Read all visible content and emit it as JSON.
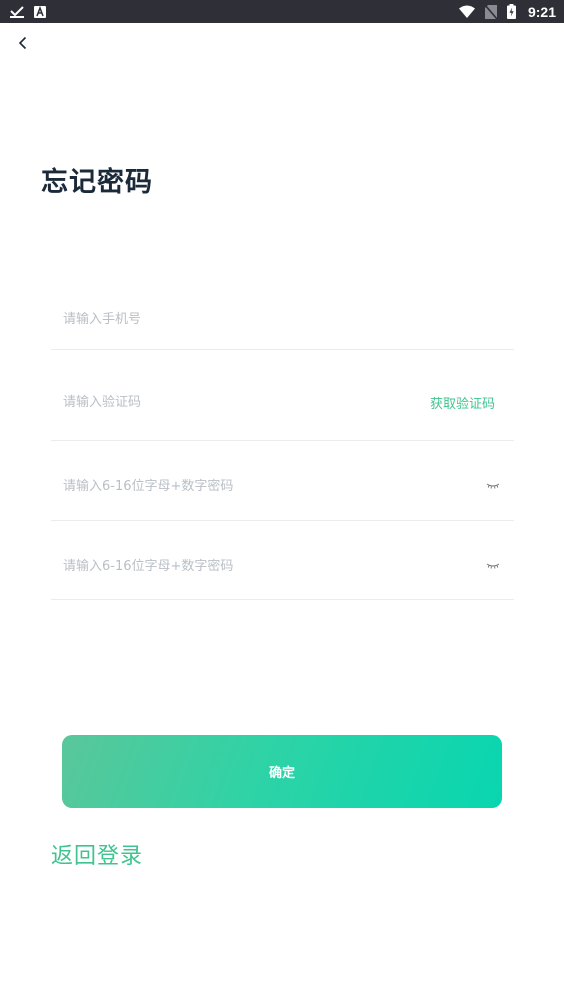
{
  "status_bar": {
    "time": "9:21",
    "left_icons": [
      "check-download-icon",
      "text-notification-icon"
    ],
    "right_icons": [
      "wifi-icon",
      "no-sim-icon",
      "battery-charging-icon"
    ],
    "bar_color": "#2f2f37"
  },
  "header": {
    "back_icon": "chevron-left-icon"
  },
  "page": {
    "title": "忘记密码"
  },
  "form": {
    "phone": {
      "placeholder": "请输入手机号",
      "value": ""
    },
    "code": {
      "placeholder": "请输入验证码",
      "value": "",
      "get_code_label": "获取验证码"
    },
    "password": {
      "placeholder": "请输入6-16位字母+数字密码",
      "value": "",
      "toggle_icon": "eye-closed-icon"
    },
    "confirm_password": {
      "placeholder": "请输入6-16位字母+数字密码",
      "value": "",
      "toggle_icon": "eye-closed-icon"
    },
    "submit_label": "确定"
  },
  "footer": {
    "back_to_login_label": "返回登录"
  },
  "colors": {
    "accent": "#3fc48f",
    "title": "#1b2a3a",
    "placeholder": "#b9bfc5",
    "button_gradient_start": "#5ac79a",
    "button_gradient_end": "#08d6b0"
  }
}
